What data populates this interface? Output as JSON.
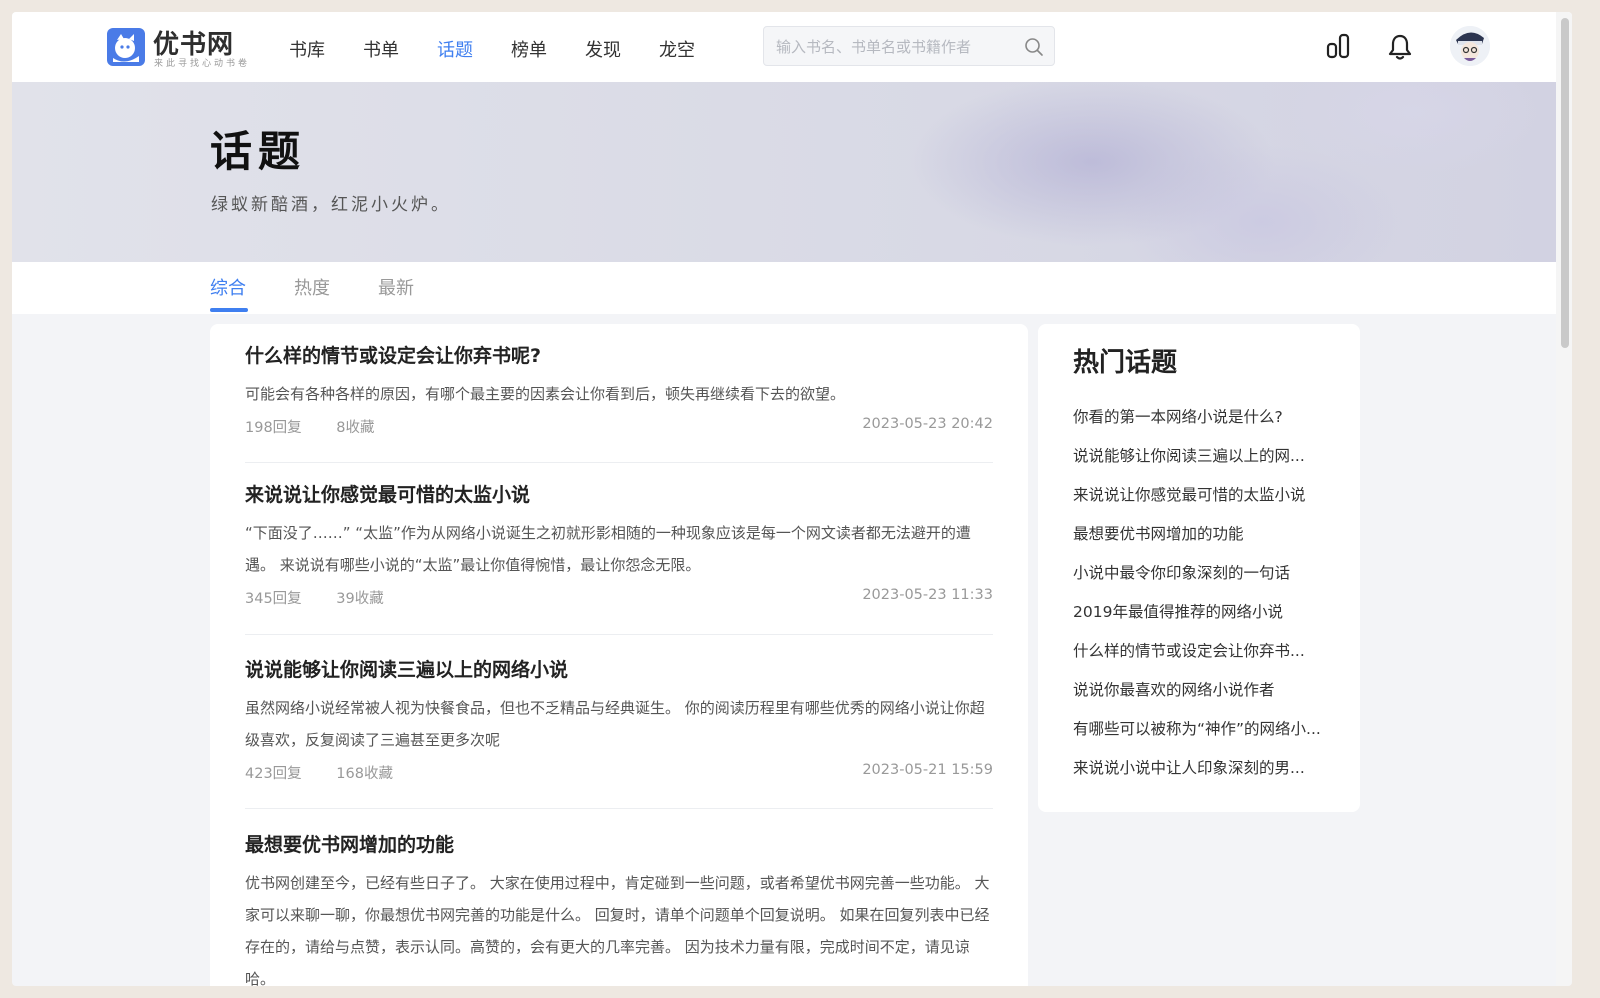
{
  "header": {
    "logo_name": "优书网",
    "logo_slogan": "来此寻找心动书卷",
    "nav": [
      {
        "label": "书库",
        "active": false
      },
      {
        "label": "书单",
        "active": false
      },
      {
        "label": "话题",
        "active": true
      },
      {
        "label": "榜单",
        "active": false
      },
      {
        "label": "发现",
        "active": false
      },
      {
        "label": "龙空",
        "active": false
      }
    ],
    "search_placeholder": "输入书名、书单名或书籍作者",
    "search_value": ""
  },
  "banner": {
    "title": "话题",
    "subtitle": "绿蚁新醅酒，红泥小火炉。"
  },
  "tabs": [
    {
      "label": "综合",
      "active": true
    },
    {
      "label": "热度",
      "active": false
    },
    {
      "label": "最新",
      "active": false
    }
  ],
  "topics": [
    {
      "title": "什么样的情节或设定会让你弃书呢?",
      "desc": "可能会有各种各样的原因，有哪个最主要的因素会让你看到后，顿失再继续看下去的欲望。",
      "replies": "198回复",
      "favorites": "8收藏",
      "time": "2023-05-23 20:42"
    },
    {
      "title": "来说说让你感觉最可惜的太监小说",
      "desc": "“下面没了……” “太监”作为从网络小说诞生之初就形影相随的一种现象应该是每一个网文读者都无法避开的遭遇。 来说说有哪些小说的“太监”最让你值得惋惜，最让你怨念无限。",
      "replies": "345回复",
      "favorites": "39收藏",
      "time": "2023-05-23 11:33"
    },
    {
      "title": "说说能够让你阅读三遍以上的网络小说",
      "desc": "虽然网络小说经常被人视为快餐食品，但也不乏精品与经典诞生。 你的阅读历程里有哪些优秀的网络小说让你超级喜欢，反复阅读了三遍甚至更多次呢",
      "replies": "423回复",
      "favorites": "168收藏",
      "time": "2023-05-21 15:59"
    },
    {
      "title": "最想要优书网增加的功能",
      "desc": "优书网创建至今，已经有些日子了。 大家在使用过程中，肯定碰到一些问题，或者希望优书网完善一些功能。 大家可以来聊一聊，你最想优书网完善的功能是什么。 回复时，请单个问题单个回复说明。 如果在回复列表中已经存在的，请给与点赞，表示认同。高赞的，会有更大的几率完善。 因为技术力量有限，完成时间不定，请见谅哈。",
      "replies": "",
      "favorites": "",
      "time": ""
    }
  ],
  "sidebar": {
    "title": "热门话题",
    "items": [
      "你看的第一本网络小说是什么?",
      "说说能够让你阅读三遍以上的网...",
      "来说说让你感觉最可惜的太监小说",
      "最想要优书网增加的功能",
      "小说中最令你印象深刻的一句话",
      "2019年最值得推荐的网络小说",
      "什么样的情节或设定会让你弃书...",
      "说说你最喜欢的网络小说作者",
      "有哪些可以被称为“神作”的网络小...",
      "来说说小说中让人印象深刻的男..."
    ]
  },
  "colors": {
    "accent": "#3f7ff0",
    "logo": "#4a7be7"
  }
}
